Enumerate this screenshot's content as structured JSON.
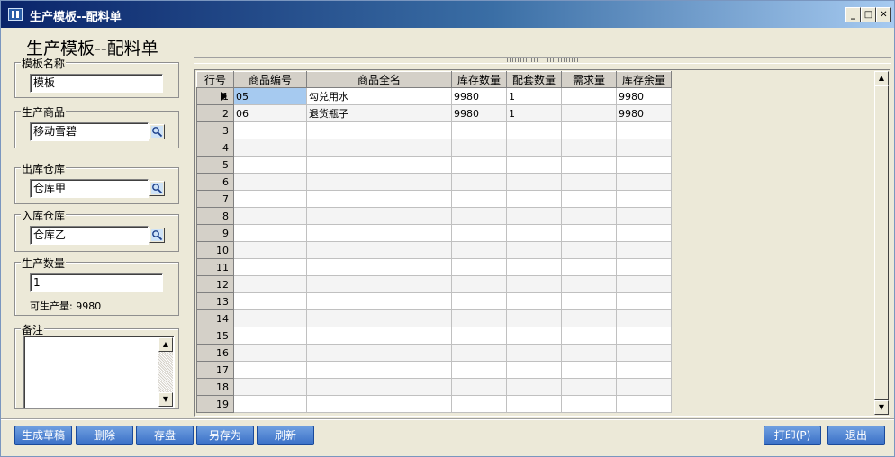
{
  "window": {
    "title": "生产模板--配料单"
  },
  "heading": "生产模板--配料单",
  "form": {
    "template_name": {
      "label": "模板名称",
      "value": "模板"
    },
    "product": {
      "label": "生产商品",
      "value": "移动雪碧"
    },
    "out_warehouse": {
      "label": "出库仓库",
      "value": "仓库甲"
    },
    "in_warehouse": {
      "label": "入库仓库",
      "value": "仓库乙"
    },
    "quantity": {
      "label": "生产数量",
      "value": "1",
      "hint": "可生产量: 9980"
    },
    "notes": {
      "label": "备注",
      "value": ""
    }
  },
  "grid": {
    "columns": [
      "行号",
      "商品编号",
      "商品全名",
      "库存数量",
      "配套数量",
      "需求量",
      "库存余量"
    ],
    "rows": [
      {
        "no": "1",
        "code": "05",
        "name": "勾兑用水",
        "stock": "9980",
        "kit_qty": "1",
        "demand": "",
        "remaining": "9980"
      },
      {
        "no": "2",
        "code": "06",
        "name": "退货瓶子",
        "stock": "9980",
        "kit_qty": "1",
        "demand": "",
        "remaining": "9980"
      },
      {
        "no": "3"
      },
      {
        "no": "4"
      },
      {
        "no": "5"
      },
      {
        "no": "6"
      },
      {
        "no": "7"
      },
      {
        "no": "8"
      },
      {
        "no": "9"
      },
      {
        "no": "10"
      },
      {
        "no": "11"
      },
      {
        "no": "12"
      },
      {
        "no": "13"
      },
      {
        "no": "14"
      },
      {
        "no": "15"
      },
      {
        "no": "16"
      },
      {
        "no": "17"
      },
      {
        "no": "18"
      },
      {
        "no": "19"
      }
    ],
    "selected_row": "1"
  },
  "buttons": {
    "draft": "生成草稿",
    "delete": "删除",
    "save": "存盘",
    "save_as": "另存为",
    "refresh": "刷新",
    "print": "打印(P)",
    "exit": "退出"
  },
  "icons": {
    "window_controls": [
      "minimize-icon",
      "maximize-icon",
      "close-icon"
    ],
    "lookup": "magnifier-icon",
    "row_pointer": "triangle-right-icon"
  },
  "colors": {
    "titlebar_start": "#0a246a",
    "titlebar_end": "#a6caf0",
    "button_blue": "#3a70c7",
    "selected_cell": "#a6caf0"
  }
}
